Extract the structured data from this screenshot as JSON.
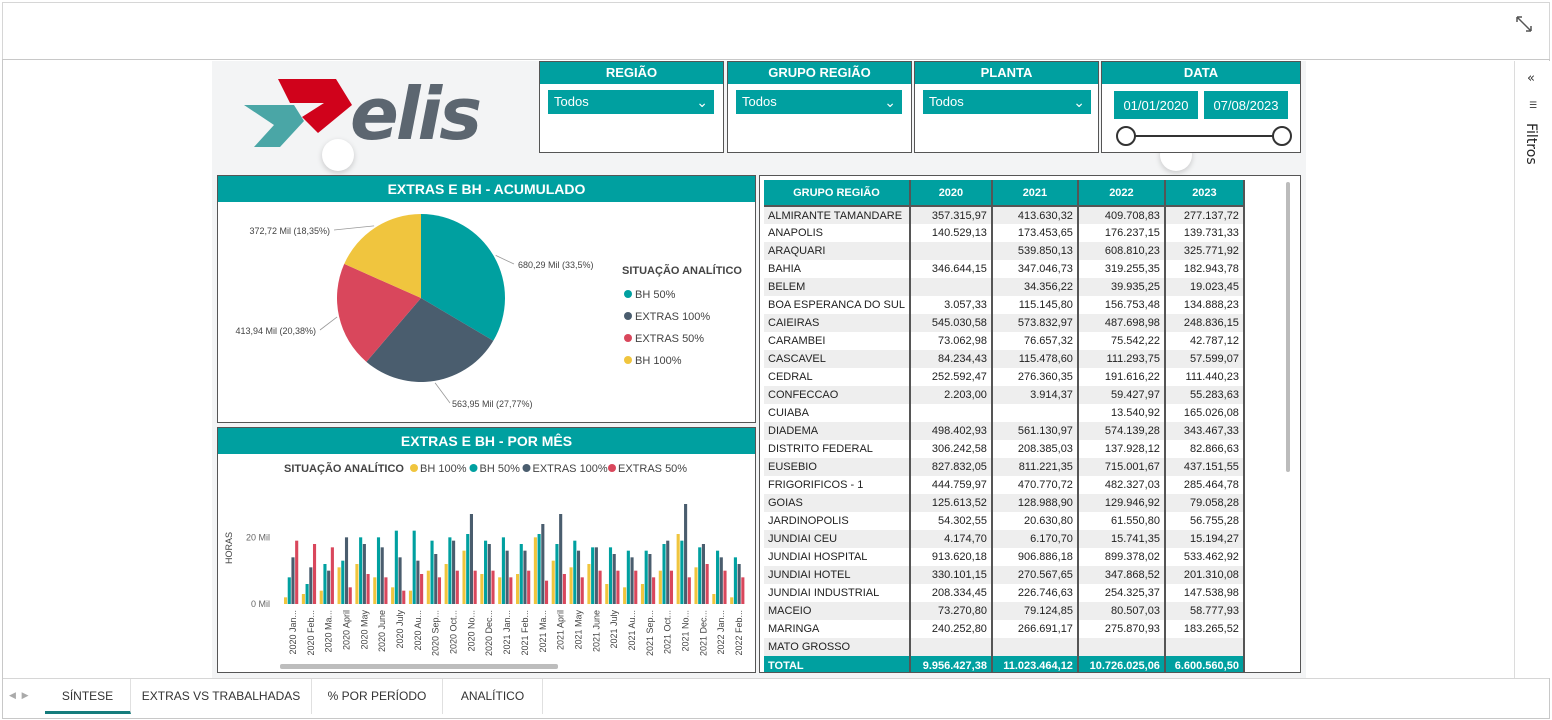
{
  "filters_label": "Filtros",
  "logo_text": "elis",
  "slicers": [
    {
      "title": "REGIÃO",
      "value": "Todos"
    },
    {
      "title": "GRUPO REGIÃO",
      "value": "Todos"
    },
    {
      "title": "PLANTA",
      "value": "Todos"
    }
  ],
  "date_slicer": {
    "title": "DATA",
    "start": "01/01/2020",
    "end": "07/08/2023"
  },
  "pie_panel": {
    "title": "EXTRAS E BH - ACUMULADO",
    "legend_title": "SITUAÇÃO ANALÍTICO"
  },
  "bar_panel": {
    "title": "EXTRAS E BH - POR MÊS",
    "legend_title": "SITUAÇÃO ANALÍTICO",
    "ylabel": "HORAS"
  },
  "chart_data": [
    {
      "type": "pie",
      "title": "EXTRAS E BH - ACUMULADO",
      "legend_title": "SITUAÇÃO ANALÍTICO",
      "slices": [
        {
          "name": "BH 50%",
          "value": 680.29,
          "label": "680,29 Mil (33,5%)",
          "color": "#00a0a0"
        },
        {
          "name": "EXTRAS 100%",
          "value": 563.95,
          "label": "563,95 Mil (27,77%)",
          "color": "#4a5d6e"
        },
        {
          "name": "EXTRAS 50%",
          "value": 413.94,
          "label": "413,94 Mil (20,38%)",
          "color": "#d9475c"
        },
        {
          "name": "BH 100%",
          "value": 372.72,
          "label": "372,72 Mil (18,35%)",
          "color": "#f0c53e"
        }
      ]
    },
    {
      "type": "bar",
      "title": "EXTRAS E BH - POR MÊS",
      "ylabel": "HORAS",
      "yticks": [
        "0 Mil",
        "20 Mil"
      ],
      "ylim": [
        0,
        30
      ],
      "categories": [
        "2020 Jan...",
        "2020 Feb...",
        "2020 Ma...",
        "2020 April",
        "2020 May",
        "2020 June",
        "2020 July",
        "2020 Au...",
        "2020 Sep...",
        "2020 Oct...",
        "2020 No...",
        "2020 Dec...",
        "2021 Jan...",
        "2021 Feb...",
        "2021 Ma...",
        "2021 April",
        "2021 May",
        "2021 June",
        "2021 July",
        "2021 Au...",
        "2021 Sep...",
        "2021 Oct...",
        "2021 No...",
        "2021 Dec...",
        "2022 Jan...",
        "2022 Feb..."
      ],
      "series": [
        {
          "name": "BH 100%",
          "color": "#f0c53e",
          "values": [
            2,
            3,
            4,
            11,
            12,
            8,
            5,
            4,
            10,
            12,
            16,
            9,
            8,
            9,
            20,
            13,
            11,
            12,
            6,
            5,
            6,
            10,
            21,
            11,
            3,
            2
          ]
        },
        {
          "name": "BH 50%",
          "color": "#00a0a0",
          "values": [
            8,
            6,
            12,
            13,
            20,
            20,
            22,
            22,
            19,
            20,
            21,
            19,
            20,
            18,
            21,
            18,
            19,
            17,
            17,
            16,
            16,
            18,
            19,
            17,
            16,
            14
          ]
        },
        {
          "name": "EXTRAS 100%",
          "color": "#4a5d6e",
          "values": [
            14,
            11,
            10,
            20,
            18,
            17,
            14,
            13,
            15,
            19,
            27,
            18,
            16,
            16,
            24,
            27,
            16,
            17,
            15,
            14,
            15,
            19,
            30,
            18,
            14,
            12
          ]
        },
        {
          "name": "EXTRAS 50%",
          "color": "#d9475c",
          "values": [
            19,
            18,
            17,
            5,
            9,
            8,
            4,
            9,
            8,
            10,
            10,
            10,
            8,
            10,
            7,
            9,
            8,
            10,
            10,
            10,
            8,
            10,
            8,
            12,
            10,
            8
          ]
        }
      ]
    }
  ],
  "table": {
    "headers": [
      "GRUPO REGIÃO",
      "2020",
      "2021",
      "2022",
      "2023"
    ],
    "rows": [
      [
        "ALMIRANTE TAMANDARE",
        "357.315,97",
        "413.630,32",
        "409.708,83",
        "277.137,72"
      ],
      [
        "ANAPOLIS",
        "140.529,13",
        "173.453,65",
        "176.237,15",
        "139.731,33"
      ],
      [
        "ARAQUARI",
        "",
        "539.850,13",
        "608.810,23",
        "325.771,92"
      ],
      [
        "BAHIA",
        "346.644,15",
        "347.046,73",
        "319.255,35",
        "182.943,78"
      ],
      [
        "BELEM",
        "",
        "34.356,22",
        "39.935,25",
        "19.023,45"
      ],
      [
        "BOA ESPERANCA DO SUL",
        "3.057,33",
        "115.145,80",
        "156.753,48",
        "134.888,23"
      ],
      [
        "CAIEIRAS",
        "545.030,58",
        "573.832,97",
        "487.698,98",
        "248.836,15"
      ],
      [
        "CARAMBEI",
        "73.062,98",
        "76.657,32",
        "75.542,22",
        "42.787,12"
      ],
      [
        "CASCAVEL",
        "84.234,43",
        "115.478,60",
        "111.293,75",
        "57.599,07"
      ],
      [
        "CEDRAL",
        "252.592,47",
        "276.360,35",
        "191.616,22",
        "111.440,23"
      ],
      [
        "CONFECCAO",
        "2.203,00",
        "3.914,37",
        "59.427,97",
        "55.283,63"
      ],
      [
        "CUIABA",
        "",
        "",
        "13.540,92",
        "165.026,08"
      ],
      [
        "DIADEMA",
        "498.402,93",
        "561.130,97",
        "574.139,28",
        "343.467,33"
      ],
      [
        "DISTRITO FEDERAL",
        "306.242,58",
        "208.385,03",
        "137.928,12",
        "82.866,63"
      ],
      [
        "EUSEBIO",
        "827.832,05",
        "811.221,35",
        "715.001,67",
        "437.151,55"
      ],
      [
        "FRIGORIFICOS - 1",
        "444.759,97",
        "470.770,72",
        "482.327,03",
        "285.464,78"
      ],
      [
        "GOIAS",
        "125.613,52",
        "128.988,90",
        "129.946,92",
        "79.058,28"
      ],
      [
        "JARDINOPOLIS",
        "54.302,55",
        "20.630,80",
        "61.550,80",
        "56.755,28"
      ],
      [
        "JUNDIAI CEU",
        "4.174,70",
        "6.170,70",
        "15.741,35",
        "15.194,27"
      ],
      [
        "JUNDIAI HOSPITAL",
        "913.620,18",
        "906.886,18",
        "899.378,02",
        "533.462,92"
      ],
      [
        "JUNDIAI HOTEL",
        "330.101,15",
        "270.567,65",
        "347.868,52",
        "201.310,08"
      ],
      [
        "JUNDIAI INDUSTRIAL",
        "208.334,45",
        "226.746,63",
        "254.325,37",
        "147.538,98"
      ],
      [
        "MACEIO",
        "73.270,80",
        "79.124,85",
        "80.507,03",
        "58.777,93"
      ],
      [
        "MARINGA",
        "240.252,80",
        "266.691,17",
        "275.870,93",
        "183.265,52"
      ],
      [
        "MATO GROSSO",
        "",
        "",
        "",
        ""
      ]
    ],
    "total": [
      "TOTAL",
      "9.956.427,38",
      "11.023.464,12",
      "10.726.025,06",
      "6.600.560,50"
    ]
  },
  "tabs": [
    "SÍNTESE",
    "EXTRAS VS TRABALHADAS",
    "% POR PERÍODO",
    "ANALÍTICO"
  ],
  "colors": {
    "accent": "#00a0a0",
    "dark": "#4a5d6e",
    "red": "#d9475c",
    "yellow": "#f0c53e",
    "logo_red": "#d0021b"
  }
}
